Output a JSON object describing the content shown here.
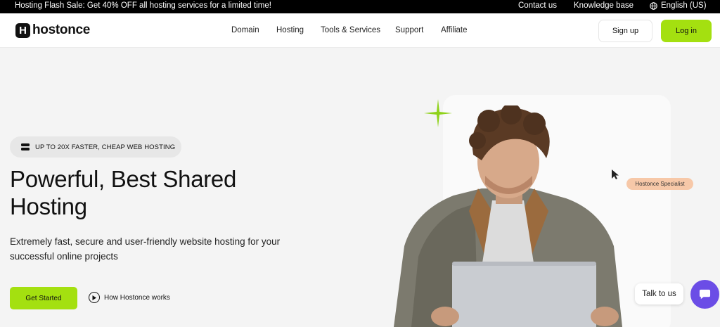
{
  "topbar": {
    "promo": "Hosting Flash Sale: Get 40% OFF all hosting services for a limited time!",
    "contact": "Contact us",
    "knowledge": "Knowledge base",
    "language": "English (US)"
  },
  "nav": {
    "logo_letter": "H",
    "logo_text": "hostonce",
    "items": [
      "Domain",
      "Hosting",
      "Tools & Services",
      "Support",
      "Affiliate"
    ],
    "signup": "Sign up",
    "login": "Log in"
  },
  "hero": {
    "badge": "UP TO 20X FASTER, CHEAP WEB HOSTING",
    "title_line1": "Powerful, Best Shared",
    "title_line2": "Hosting",
    "subtitle": "Extremely fast, secure and user-friendly website hosting for your successful online projects",
    "cta": "Get Started",
    "how": "How Hostonce works",
    "specialist_tag": "Hostonce Specialist"
  },
  "chat": {
    "talk": "Talk to us"
  },
  "colors": {
    "accent": "#a4e010",
    "chat": "#6b4de6",
    "tag": "#f7c8a8"
  }
}
